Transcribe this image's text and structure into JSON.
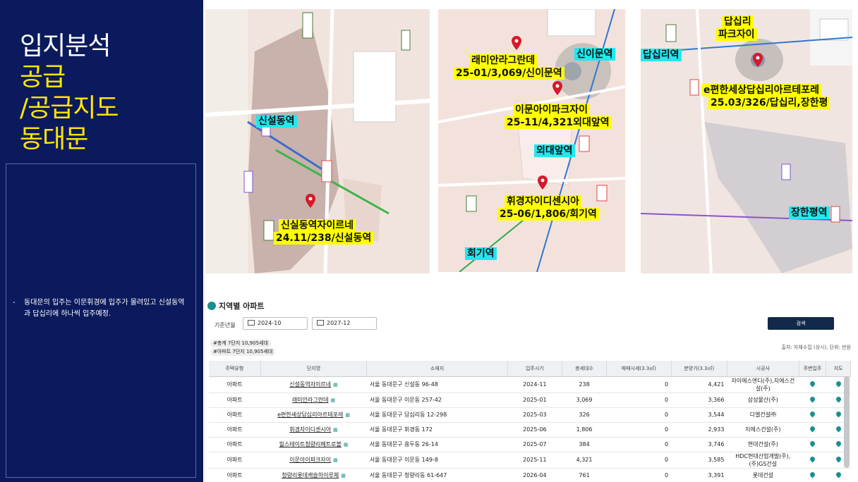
{
  "slide": {
    "title_line1": "입지분석",
    "title_line2": "공급",
    "title_line3": "/공급지도",
    "title_line4": "동대문",
    "note_dash": "-",
    "note_text": "동대문의 입주는 이문휘경에 입주가 몰려있고 신설동역과 답십리에 하나씩 입주예정."
  },
  "maps": {
    "map1": {
      "station": "신설동역",
      "complex_name": "신실동역자이르네",
      "complex_info": "24.11/238/신설동역"
    },
    "map2": {
      "station_sinimun": "신이문역",
      "station_hufs": "외대앞역",
      "station_hoegi": "회기역",
      "c1_name": "래미안라그란데",
      "c1_info": "25-01/3,069/신이문역",
      "c2_name": "이문아이파크자이",
      "c2_info": "25-11/4,321외대앞역",
      "c3_name": "휘경자이디센시아",
      "c3_info": "25-06/1,806/회기역"
    },
    "map3": {
      "station_dapsimni": "답십리역",
      "station_janghanpyeong": "장한평역",
      "c1_name": "답십리",
      "c1_name2": "파크자이",
      "c2_name": "e편한세상답십리아르테포레",
      "c2_info": "25.03/326/답십리,장한평"
    }
  },
  "panel": {
    "title": "지역별 아파트",
    "basis_label": "기준년월",
    "date_from": "2024-10",
    "date_to": "2027-12",
    "search_label": "검색",
    "count_total": "#총계 7단지 10,905세대",
    "count_apt": "#아파트 7단지 10,905세대",
    "source_note": "출처: 자체수집 (상시), 단위: 만원",
    "headers": [
      "주택유형",
      "단지명",
      "소재지",
      "입주시기",
      "총세대수",
      "매매시세(3.3㎡)",
      "분양가(3.3㎡)",
      "시공사",
      "주변입주",
      "지도"
    ],
    "rows": [
      {
        "type": "아파트",
        "name": "신설동역자이르네",
        "addr": "서울 동대문구 신설동 96-48",
        "date": "2024-11",
        "units": "238",
        "trade": "0",
        "price": "4,421",
        "builder": "자이에스엔디(주),지에스건설(주)"
      },
      {
        "type": "아파트",
        "name": "래미안라그란데",
        "addr": "서울 동대문구 이문동 257-42",
        "date": "2025-01",
        "units": "3,069",
        "trade": "0",
        "price": "3,366",
        "builder": "삼성물산(주)"
      },
      {
        "type": "아파트",
        "name": "e편한세상답십리아르테포레",
        "addr": "서울 동대문구 답십리동 12-298",
        "date": "2025-03",
        "units": "326",
        "trade": "0",
        "price": "3,544",
        "builder": "디엘건설㈜"
      },
      {
        "type": "아파트",
        "name": "휘경자이디센시아",
        "addr": "서울 동대문구 휘경동 172",
        "date": "2025-06",
        "units": "1,806",
        "trade": "0",
        "price": "2,933",
        "builder": "지에스건설(주)"
      },
      {
        "type": "아파트",
        "name": "힐스테이트청량리메트로블",
        "addr": "서울 동대문구 용두동 26-14",
        "date": "2025-07",
        "units": "384",
        "trade": "0",
        "price": "3,746",
        "builder": "현대건설(주)"
      },
      {
        "type": "아파트",
        "name": "이문아이파크자이",
        "addr": "서울 동대문구 이문동 149-8",
        "date": "2025-11",
        "units": "4,321",
        "trade": "0",
        "price": "3,585",
        "builder": "HDC현대산업개발(주),(주)GS건설"
      },
      {
        "type": "아파트",
        "name": "청량리롯데캐슬하이루체",
        "addr": "서울 동대문구 청량리동 61-647",
        "date": "2026-04",
        "units": "761",
        "trade": "0",
        "price": "3,391",
        "builder": "롯데건설"
      }
    ]
  },
  "colors": {
    "navy": "#0b1a5c",
    "accent_yellow": "#ffe600",
    "label_yellow": "#ffff00",
    "label_cyan": "#22e8ee",
    "pin_red": "#d7192a"
  }
}
